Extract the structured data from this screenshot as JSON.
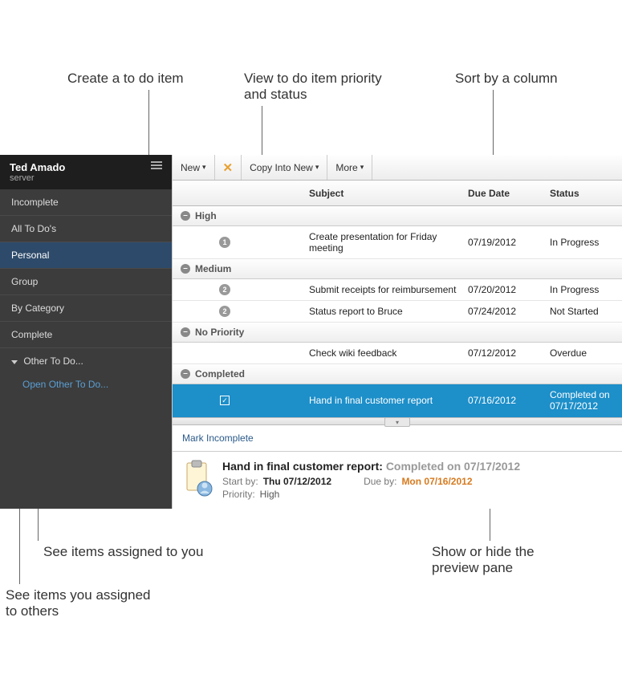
{
  "callouts": {
    "create": "Create a to do item",
    "view": "View to do item priority\nand status",
    "sort": "Sort by a column",
    "assigned_to_you": "See items assigned to you",
    "assigned_to_others": "See items you assigned\nto others",
    "preview": "Show or hide the\npreview pane"
  },
  "sidebar": {
    "user": "Ted Amado",
    "sub": "server",
    "items": [
      {
        "label": "Incomplete"
      },
      {
        "label": "All To Do's"
      },
      {
        "label": "Personal"
      },
      {
        "label": "Group"
      },
      {
        "label": "By Category"
      },
      {
        "label": "Complete"
      }
    ],
    "other": {
      "label": "Other To Do...",
      "link": "Open Other To Do..."
    }
  },
  "toolbar": {
    "new": "New",
    "copy": "Copy Into New",
    "more": "More"
  },
  "columns": {
    "subject": "Subject",
    "due": "Due Date",
    "status": "Status"
  },
  "groups": [
    {
      "label": "High",
      "rows": [
        {
          "priority": "1",
          "subject": "Create presentation for Friday meeting",
          "due": "07/19/2012",
          "status": "In Progress"
        }
      ]
    },
    {
      "label": "Medium",
      "rows": [
        {
          "priority": "2",
          "subject": "Submit receipts for reimbursement",
          "due": "07/20/2012",
          "status": "In Progress"
        },
        {
          "priority": "2",
          "subject": "Status report to Bruce",
          "due": "07/24/2012",
          "status": "Not Started"
        }
      ]
    },
    {
      "label": "No Priority",
      "rows": [
        {
          "priority": "",
          "subject": "Check wiki feedback",
          "due": "07/12/2012",
          "status": "Overdue"
        }
      ]
    },
    {
      "label": "Completed",
      "rows": [
        {
          "priority": "check",
          "subject": "Hand in final customer report",
          "due": "07/16/2012",
          "status": "Completed on 07/17/2012",
          "selected": true
        }
      ]
    }
  ],
  "preview": {
    "action": "Mark Incomplete",
    "title": "Hand in final customer report:",
    "completed": "Completed on 07/17/2012",
    "start_label": "Start by:",
    "start_val": "Thu 07/12/2012",
    "due_label": "Due by:",
    "due_val": "Mon 07/16/2012",
    "priority_label": "Priority:",
    "priority_val": "High"
  }
}
